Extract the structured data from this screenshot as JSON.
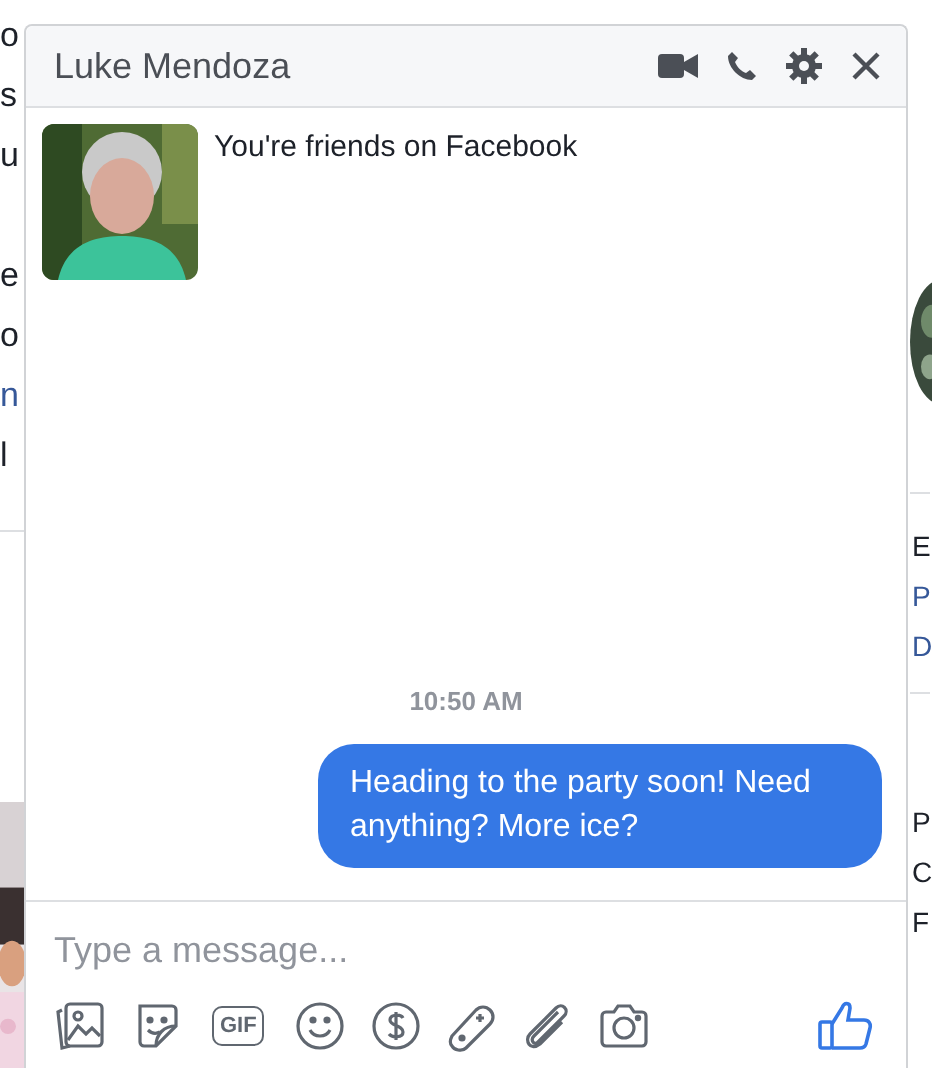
{
  "background": {
    "left_fragments": [
      {
        "text": "o",
        "kind": "text"
      },
      {
        "text": "s",
        "kind": "text"
      },
      {
        "text": "u",
        "kind": "text"
      },
      {
        "text": "e",
        "kind": "text"
      },
      {
        "text": "o",
        "kind": "text"
      },
      {
        "text": "n",
        "kind": "link"
      },
      {
        "text": "l",
        "kind": "text"
      }
    ],
    "right_top_fragments": [
      {
        "text": "E",
        "kind": "text"
      },
      {
        "text": "P",
        "kind": "link"
      },
      {
        "text": "D",
        "kind": "link"
      }
    ],
    "right_bottom_fragments": [
      "P",
      "C",
      "F"
    ]
  },
  "chat": {
    "title": "Luke Mendoza",
    "intro": "You're friends on Facebook",
    "timestamp": "10:50 AM",
    "messages": [
      {
        "text": "Heading to the party soon! Need anything? More ice?",
        "outgoing": true
      }
    ],
    "composer": {
      "placeholder": "Type a message..."
    },
    "gif_label": "GIF"
  }
}
